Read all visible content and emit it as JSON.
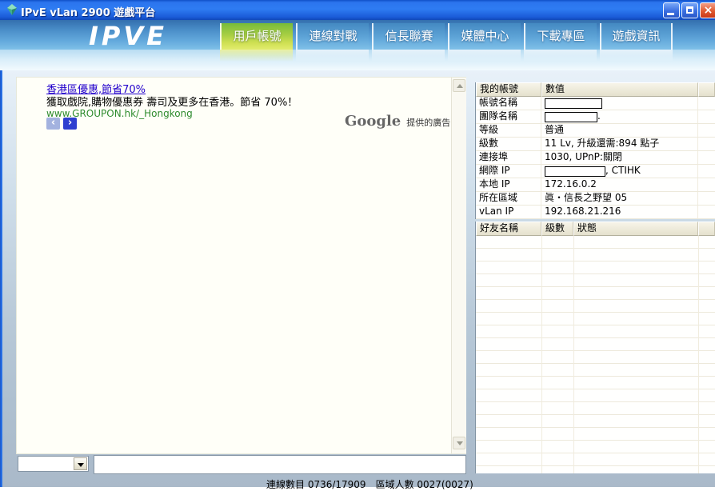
{
  "window": {
    "title": "IPvE vLan 2900 遊戲平台"
  },
  "logo_text": "IPVE",
  "nav_tabs": [
    {
      "id": "user-account",
      "label": "用戶帳號",
      "active": true
    },
    {
      "id": "online-battle",
      "label": "連線對戰",
      "active": false
    },
    {
      "id": "nobunaga-league",
      "label": "信長聯賽",
      "active": false
    },
    {
      "id": "media-center",
      "label": "媒體中心",
      "active": false
    },
    {
      "id": "download-zone",
      "label": "下載專區",
      "active": false
    },
    {
      "id": "game-info",
      "label": "遊戲資訊",
      "active": false
    }
  ],
  "ad": {
    "headline": "香港區優惠,節省70%",
    "body": "獲取戲院,購物優惠券 壽司及更多在香港。節省 70%！",
    "url": "www.GROUPON.hk/_Hongkong",
    "google": "Google",
    "google_suffix": "提供的廣告",
    "prev": "‹",
    "next": "›"
  },
  "account_table": {
    "headers": [
      "我的帳號",
      "數值",
      ""
    ],
    "rows": [
      {
        "id": "account-name",
        "label": "帳號名稱",
        "value": "",
        "redacted": true
      },
      {
        "id": "team-name",
        "label": "團隊名稱",
        "value": ".",
        "redacted": true
      },
      {
        "id": "level",
        "label": "等級",
        "value": "普通",
        "redacted": false
      },
      {
        "id": "grade",
        "label": "級數",
        "value": "11 Lv, 升級還需:894 點子",
        "redacted": false
      },
      {
        "id": "port",
        "label": "連接埠",
        "value": "1030, UPnP:關閉",
        "redacted": false
      },
      {
        "id": "wan-ip",
        "label": "網際 IP",
        "value": ", CTIHK",
        "redacted": true
      },
      {
        "id": "local-ip",
        "label": "本地 IP",
        "value": "172.16.0.2",
        "redacted": false
      },
      {
        "id": "region",
        "label": "所在區域",
        "value": "眞・信長之野望 05",
        "redacted": false
      },
      {
        "id": "vlan-ip",
        "label": "vLan IP",
        "value": "192.168.21.216",
        "redacted": false
      }
    ]
  },
  "friends_table": {
    "headers": [
      "好友名稱",
      "級數",
      "狀態",
      ""
    ]
  },
  "bottom": {
    "combo_value": "",
    "input_value": "",
    "status": "連線數目 0736/17909　區域人數 0027(0027)"
  }
}
